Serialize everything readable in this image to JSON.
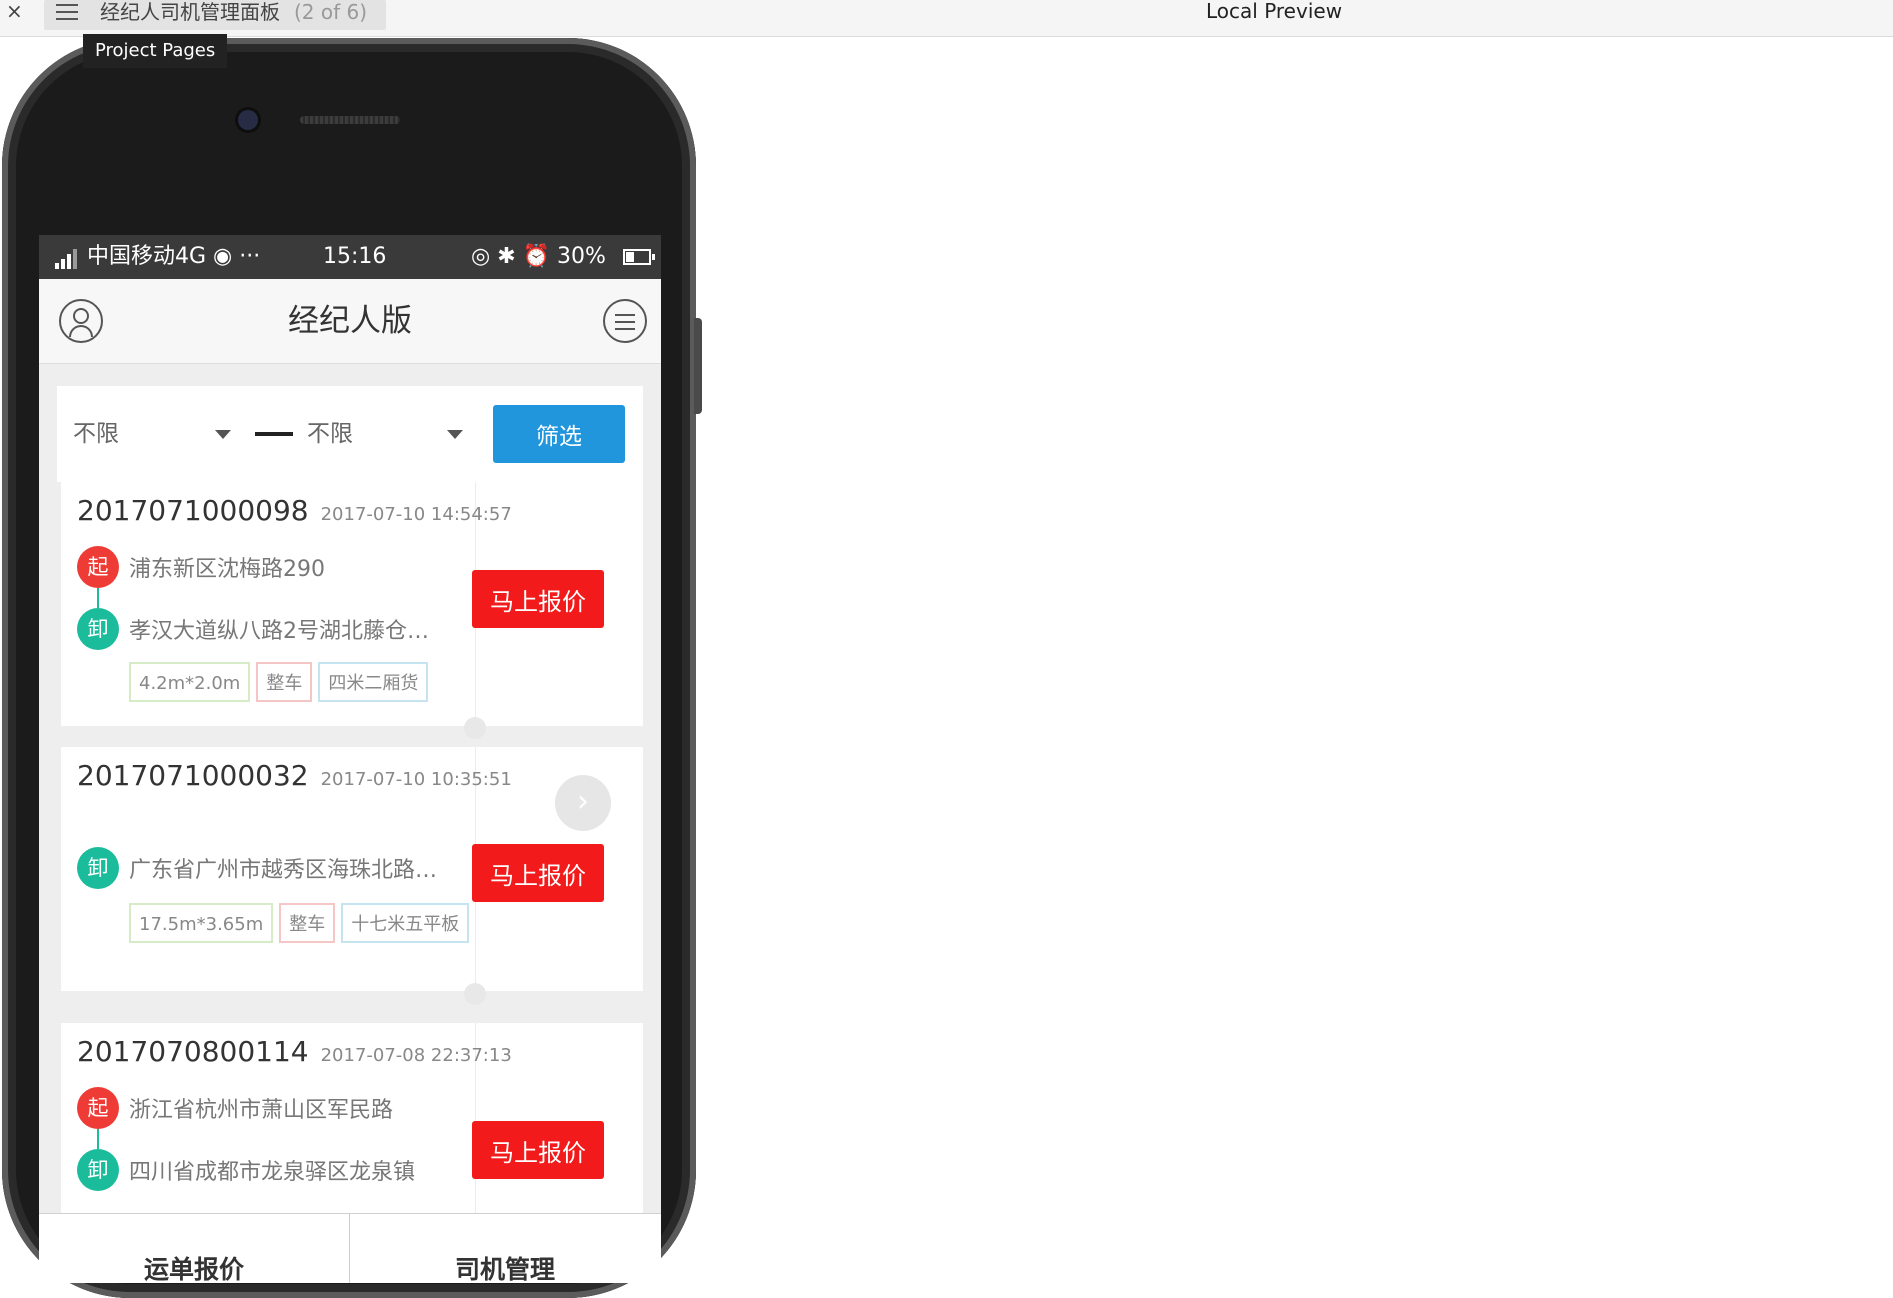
{
  "window": {
    "close_glyph": "×",
    "tab_title": "经纪人司机管理面板",
    "tab_count": "(2 of 6)",
    "preview_title": "Local Preview",
    "tooltip": "Project Pages"
  },
  "statusbar": {
    "carrier": "中国移动4G",
    "wifi_glyph": "◉",
    "dots": "···",
    "time": "15:16",
    "right_icons": "◎ ✱ ⏰",
    "battery": "30%"
  },
  "navbar": {
    "title": "经纪人版"
  },
  "filter": {
    "from_value": "不限",
    "to_value": "不限",
    "button_label": "筛选"
  },
  "orders": [
    {
      "order_no": "2017071000098",
      "time": "2017-07-10 14:54:57",
      "start_badge": "起",
      "start_address": "浦东新区沈梅路290",
      "end_badge": "卸",
      "end_address": "孝汉大道纵八路2号湖北藤仓…",
      "tags": [
        "4.2m*2.0m",
        "整车",
        "四米二厢货"
      ],
      "quote_label": "马上报价"
    },
    {
      "order_no": "2017071000032",
      "time": "2017-07-10 10:35:51",
      "end_badge": "卸",
      "end_address": "广东省广州市越秀区海珠北路…",
      "tags": [
        "17.5m*3.65m",
        "整车",
        "十七米五平板"
      ],
      "quote_label": "马上报价"
    },
    {
      "order_no": "2017070800114",
      "time": "2017-07-08 22:37:13",
      "start_badge": "起",
      "start_address": "浙江省杭州市萧山区军民路",
      "end_badge": "卸",
      "end_address": "四川省成都市龙泉驿区龙泉镇",
      "quote_label": "马上报价"
    }
  ],
  "bottom_tabs": [
    "运单报价",
    "司机管理"
  ],
  "colors": {
    "filter_button": "#2196dc",
    "quote_button": "#f21a1a",
    "start_badge": "#ef3b36",
    "end_badge": "#1abc9c"
  }
}
